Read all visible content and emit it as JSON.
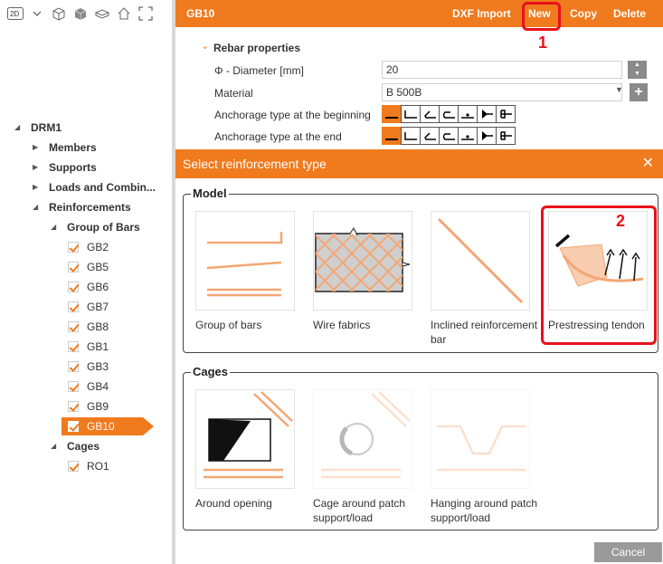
{
  "toolbar": {
    "view_label": "2D"
  },
  "tree": {
    "root": "DRM1",
    "members": "Members",
    "supports": "Supports",
    "loads": "Loads and Combin...",
    "reinforcements": "Reinforcements",
    "group_of_bars": "Group of Bars",
    "bars": [
      "GB2",
      "GB5",
      "GB6",
      "GB7",
      "GB8",
      "GB1",
      "GB3",
      "GB4",
      "GB9",
      "GB10"
    ],
    "selected": "GB10",
    "cages": "Cages",
    "cage_items": [
      "RO1"
    ]
  },
  "header": {
    "title": "GB10",
    "dxf_import": "DXF Import",
    "new": "New",
    "copy": "Copy",
    "delete": "Delete"
  },
  "annotations": {
    "one": "1",
    "two": "2",
    "color": "#e8101a"
  },
  "props": {
    "section": "Rebar properties",
    "diameter_label": "Φ - Diameter [mm]",
    "diameter_value": "20",
    "material_label": "Material",
    "material_value": "B 500B",
    "anchor_begin_label": "Anchorage type at the beginning",
    "anchor_end_label": "Anchorage type at the end"
  },
  "dialog": {
    "title": "Select reinforcement type",
    "model_title": "Model",
    "model_tiles": [
      {
        "label": "Group of bars"
      },
      {
        "label": "Wire fabrics"
      },
      {
        "label": "Inclined reinforcement bar"
      },
      {
        "label": "Prestressing tendon"
      }
    ],
    "cages_title": "Cages",
    "cage_tiles": [
      {
        "label": "Around opening"
      },
      {
        "label": "Cage around patch support/load"
      },
      {
        "label": "Hanging around patch support/load"
      }
    ],
    "cancel": "Cancel"
  },
  "colors": {
    "accent": "#f07a1e",
    "annotation": "#e8101a"
  }
}
